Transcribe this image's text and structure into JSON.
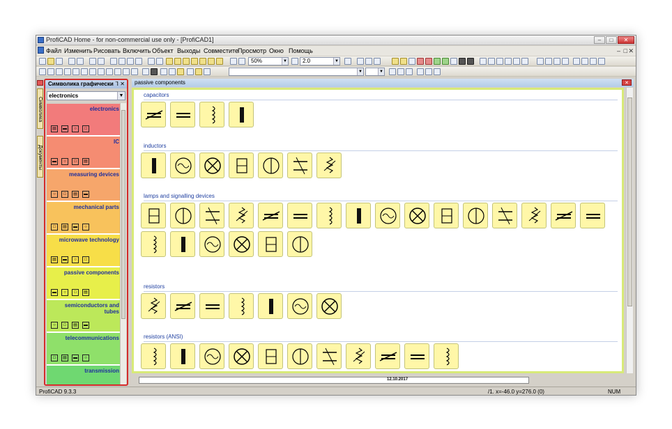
{
  "window": {
    "title": "ProfiCAD Home - for non-commercial use only - [ProfiCAD1]"
  },
  "menu": [
    "Файл",
    "Изменить",
    "Рисовать",
    "Включить",
    "Объект",
    "Выходы",
    "Совместите",
    "Просмотр",
    "Окно",
    "Помощь"
  ],
  "toolbar": {
    "zoom_value": "50%",
    "grid_value": "2.0"
  },
  "side_tabs": [
    "Символика",
    "Документы"
  ],
  "symbols_panel": {
    "title": "Символика графически",
    "pin": "⅂",
    "close": "✕",
    "category_select": "electronics",
    "categories": [
      {
        "label": "electronics",
        "color": "#f27b7b"
      },
      {
        "label": "IC",
        "color": "#f58c72"
      },
      {
        "label": "measuring devices",
        "color": "#f6a66b"
      },
      {
        "label": "mechanical parts",
        "color": "#f8c25c"
      },
      {
        "label": "microwave technology",
        "color": "#f7de48"
      },
      {
        "label": "passive components",
        "color": "#e7ef4a"
      },
      {
        "label": "semiconductors and tubes",
        "color": "#bce85a"
      },
      {
        "label": "telecommunications",
        "color": "#8fe06a"
      },
      {
        "label": "transmission",
        "color": "#6fd871"
      }
    ]
  },
  "document": {
    "tab_label": "passive components",
    "close": "✕"
  },
  "palette": {
    "sections": [
      {
        "label": "capacitors",
        "count": 4
      },
      {
        "label": "inductors",
        "count": 7
      },
      {
        "label": "lamps and signalling devices",
        "count": 22
      },
      {
        "label": "resistors",
        "count": 7
      },
      {
        "label": "resistors (ANSI)",
        "count": 11
      }
    ]
  },
  "drawing_frame": {
    "date": "12.10.2017"
  },
  "statusbar": {
    "version": "ProfiCAD 9.3.3",
    "coords": "/1.  x=-46.0  y=276.0 (0)",
    "num": "NUM"
  }
}
